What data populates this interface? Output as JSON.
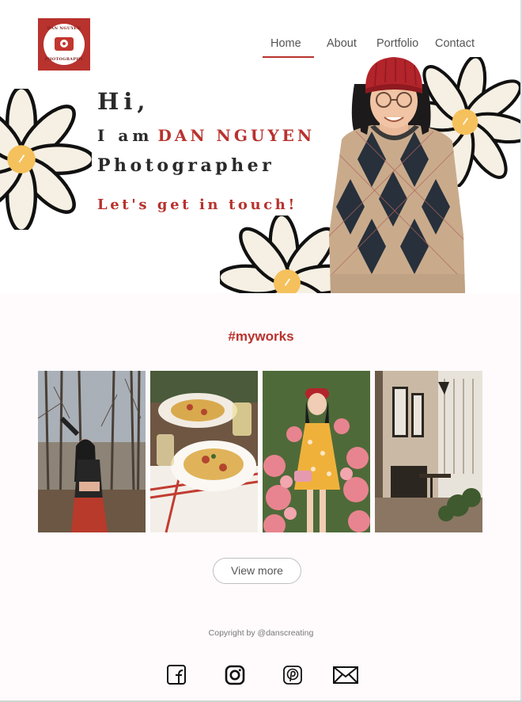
{
  "logo": {
    "top_text": "DAN NGUYEN",
    "bottom_text": "PHOTOGRAPHY"
  },
  "nav": {
    "items": [
      "Home",
      "About",
      "Portfolio",
      "Contact"
    ],
    "active": "Home"
  },
  "hero": {
    "greeting": "Hi,",
    "intro": "I am",
    "name": "DAN NGUYEN",
    "role": "Photographer",
    "cta": "Let's get in touch!"
  },
  "works": {
    "title": "#myworks",
    "photos": [
      "forest portrait",
      "pasta dishes",
      "girl with flowers",
      "cafe interior"
    ]
  },
  "view_more": "View more",
  "footer": {
    "copyright": "Copyright by @danscreating",
    "social": [
      "facebook-icon",
      "instagram-icon",
      "pinterest-icon",
      "mail-icon"
    ]
  },
  "colors": {
    "accent": "#b8322e",
    "text": "#2a2a2a",
    "flower_center": "#f5c15c",
    "petal": "#f6f0e4"
  }
}
